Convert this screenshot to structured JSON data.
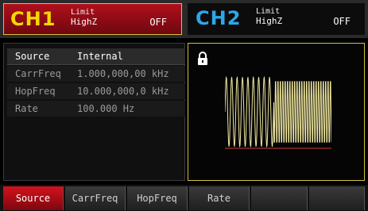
{
  "channels": {
    "ch1": {
      "name": "CH1",
      "limit_label": "Limit",
      "load": "HighZ",
      "state": "OFF"
    },
    "ch2": {
      "name": "CH2",
      "limit_label": "Limit",
      "load": "HighZ",
      "state": "OFF"
    }
  },
  "params": {
    "source": {
      "name": "Source",
      "value": "Internal"
    },
    "carrfreq": {
      "name": "CarrFreq",
      "value": "1.000,000,00 kHz"
    },
    "hopfreq": {
      "name": "HopFreq",
      "value": "10.000,000,0 kHz"
    },
    "rate": {
      "name": "Rate",
      "value": "100.000 Hz"
    }
  },
  "waveform": {
    "lock_icon": "lock-icon",
    "signal_color": "#f0e8a0",
    "baseline_color": "#d23a3a"
  },
  "softkeys": {
    "k1": "Source",
    "k2": "CarrFreq",
    "k3": "HopFreq",
    "k4": "Rate",
    "k5": "",
    "k6": ""
  },
  "colors": {
    "ch1_accent": "#f5d800",
    "ch1_bg": "#a0101a",
    "ch2_accent": "#2ea7e8",
    "active_key": "#c0121b"
  }
}
